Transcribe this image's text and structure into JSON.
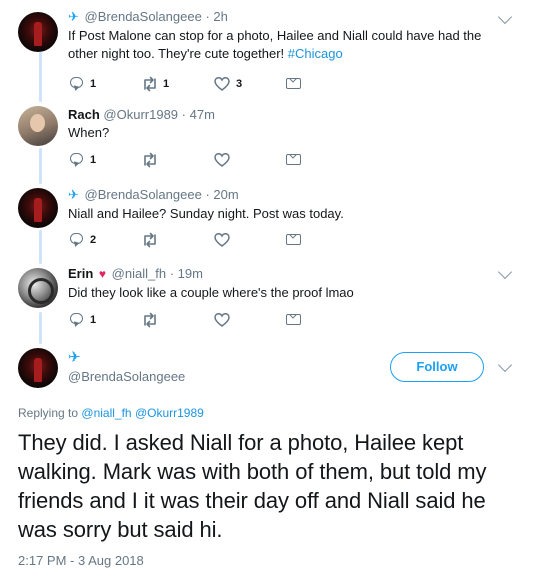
{
  "tweets": [
    {
      "display_name": "",
      "handle": "@BrendaSolangeee",
      "time": "2h",
      "text": "If Post Malone can stop for a photo, Hailee and Niall could have had the other night too. They're cute together! ",
      "hashtag": "#Chicago",
      "reply_count": "1",
      "retweet_count": "1",
      "like_count": "3"
    },
    {
      "display_name": "Rach",
      "handle": "@Okurr1989",
      "time": "47m",
      "text": "When?",
      "reply_count": "1",
      "retweet_count": "",
      "like_count": ""
    },
    {
      "display_name": "",
      "handle": "@BrendaSolangeee",
      "time": "20m",
      "text": "Niall and Hailee? Sunday night. Post was today.",
      "reply_count": "2",
      "retweet_count": "",
      "like_count": ""
    },
    {
      "display_name": "Erin",
      "handle": "@niall_fh",
      "time": "19m",
      "text": "Did they look like a couple where's the proof lmao",
      "reply_count": "1",
      "retweet_count": "",
      "like_count": ""
    }
  ],
  "main_tweet": {
    "handle": "@BrendaSolangeee",
    "follow_label": "Follow",
    "replying_label": "Replying to",
    "replying_to": [
      "@niall_fh",
      "@Okurr1989"
    ],
    "text": "They did. I asked Niall for a photo, Hailee kept walking. Mark was with both of them, but told my friends and I it was their day off and Niall said he was sorry but said hi.",
    "timestamp": "2:17 PM - 3 Aug 2018"
  },
  "glyphs": {
    "plane": "✈",
    "heart": "♥",
    "separator": "·"
  },
  "colors": {
    "accent": "#1da1f2",
    "link": "#1b95e0",
    "muted": "#657786",
    "thread_line": "#cfe3ff"
  }
}
